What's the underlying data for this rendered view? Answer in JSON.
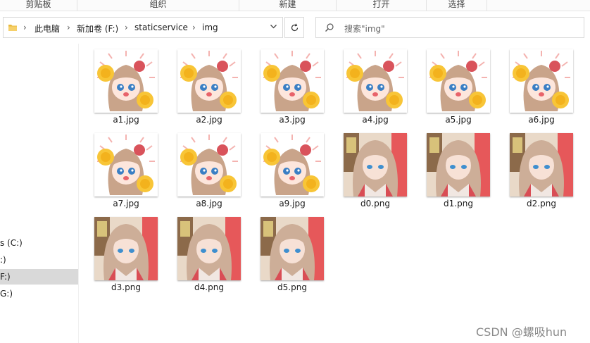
{
  "ribbon": {
    "groups": [
      "剪贴板",
      "组织",
      "新建",
      "打开",
      "选择"
    ]
  },
  "address": {
    "crumbs": [
      "此电脑",
      "新加卷 (F:)",
      "staticservice",
      "img"
    ]
  },
  "search": {
    "placeholder": "搜索\"img\""
  },
  "nav": {
    "items": [
      {
        "label": "s (C:)",
        "selected": false
      },
      {
        "label": ":)",
        "selected": false
      },
      {
        "label": "F:)",
        "selected": true
      },
      {
        "label": "G:)",
        "selected": false
      }
    ]
  },
  "files": [
    {
      "name": "a1.jpg",
      "kind": "cheer"
    },
    {
      "name": "a2.jpg",
      "kind": "cheer"
    },
    {
      "name": "a3.jpg",
      "kind": "cheer"
    },
    {
      "name": "a4.jpg",
      "kind": "cheer"
    },
    {
      "name": "a5.jpg",
      "kind": "cheer"
    },
    {
      "name": "a6.jpg",
      "kind": "cheer"
    },
    {
      "name": "a7.jpg",
      "kind": "cheer"
    },
    {
      "name": "a8.jpg",
      "kind": "cheer"
    },
    {
      "name": "a9.jpg",
      "kind": "cheer"
    },
    {
      "name": "d0.png",
      "kind": "portrait"
    },
    {
      "name": "d1.png",
      "kind": "portrait"
    },
    {
      "name": "d2.png",
      "kind": "portrait"
    },
    {
      "name": "d3.png",
      "kind": "portrait"
    },
    {
      "name": "d4.png",
      "kind": "portrait"
    },
    {
      "name": "d5.png",
      "kind": "portrait"
    }
  ],
  "watermark": "CSDN @螺吸hun",
  "icons": {
    "folder": "folder-icon",
    "search": "search-icon",
    "refresh": "refresh-icon",
    "dropdown": "chevron-down-icon"
  }
}
